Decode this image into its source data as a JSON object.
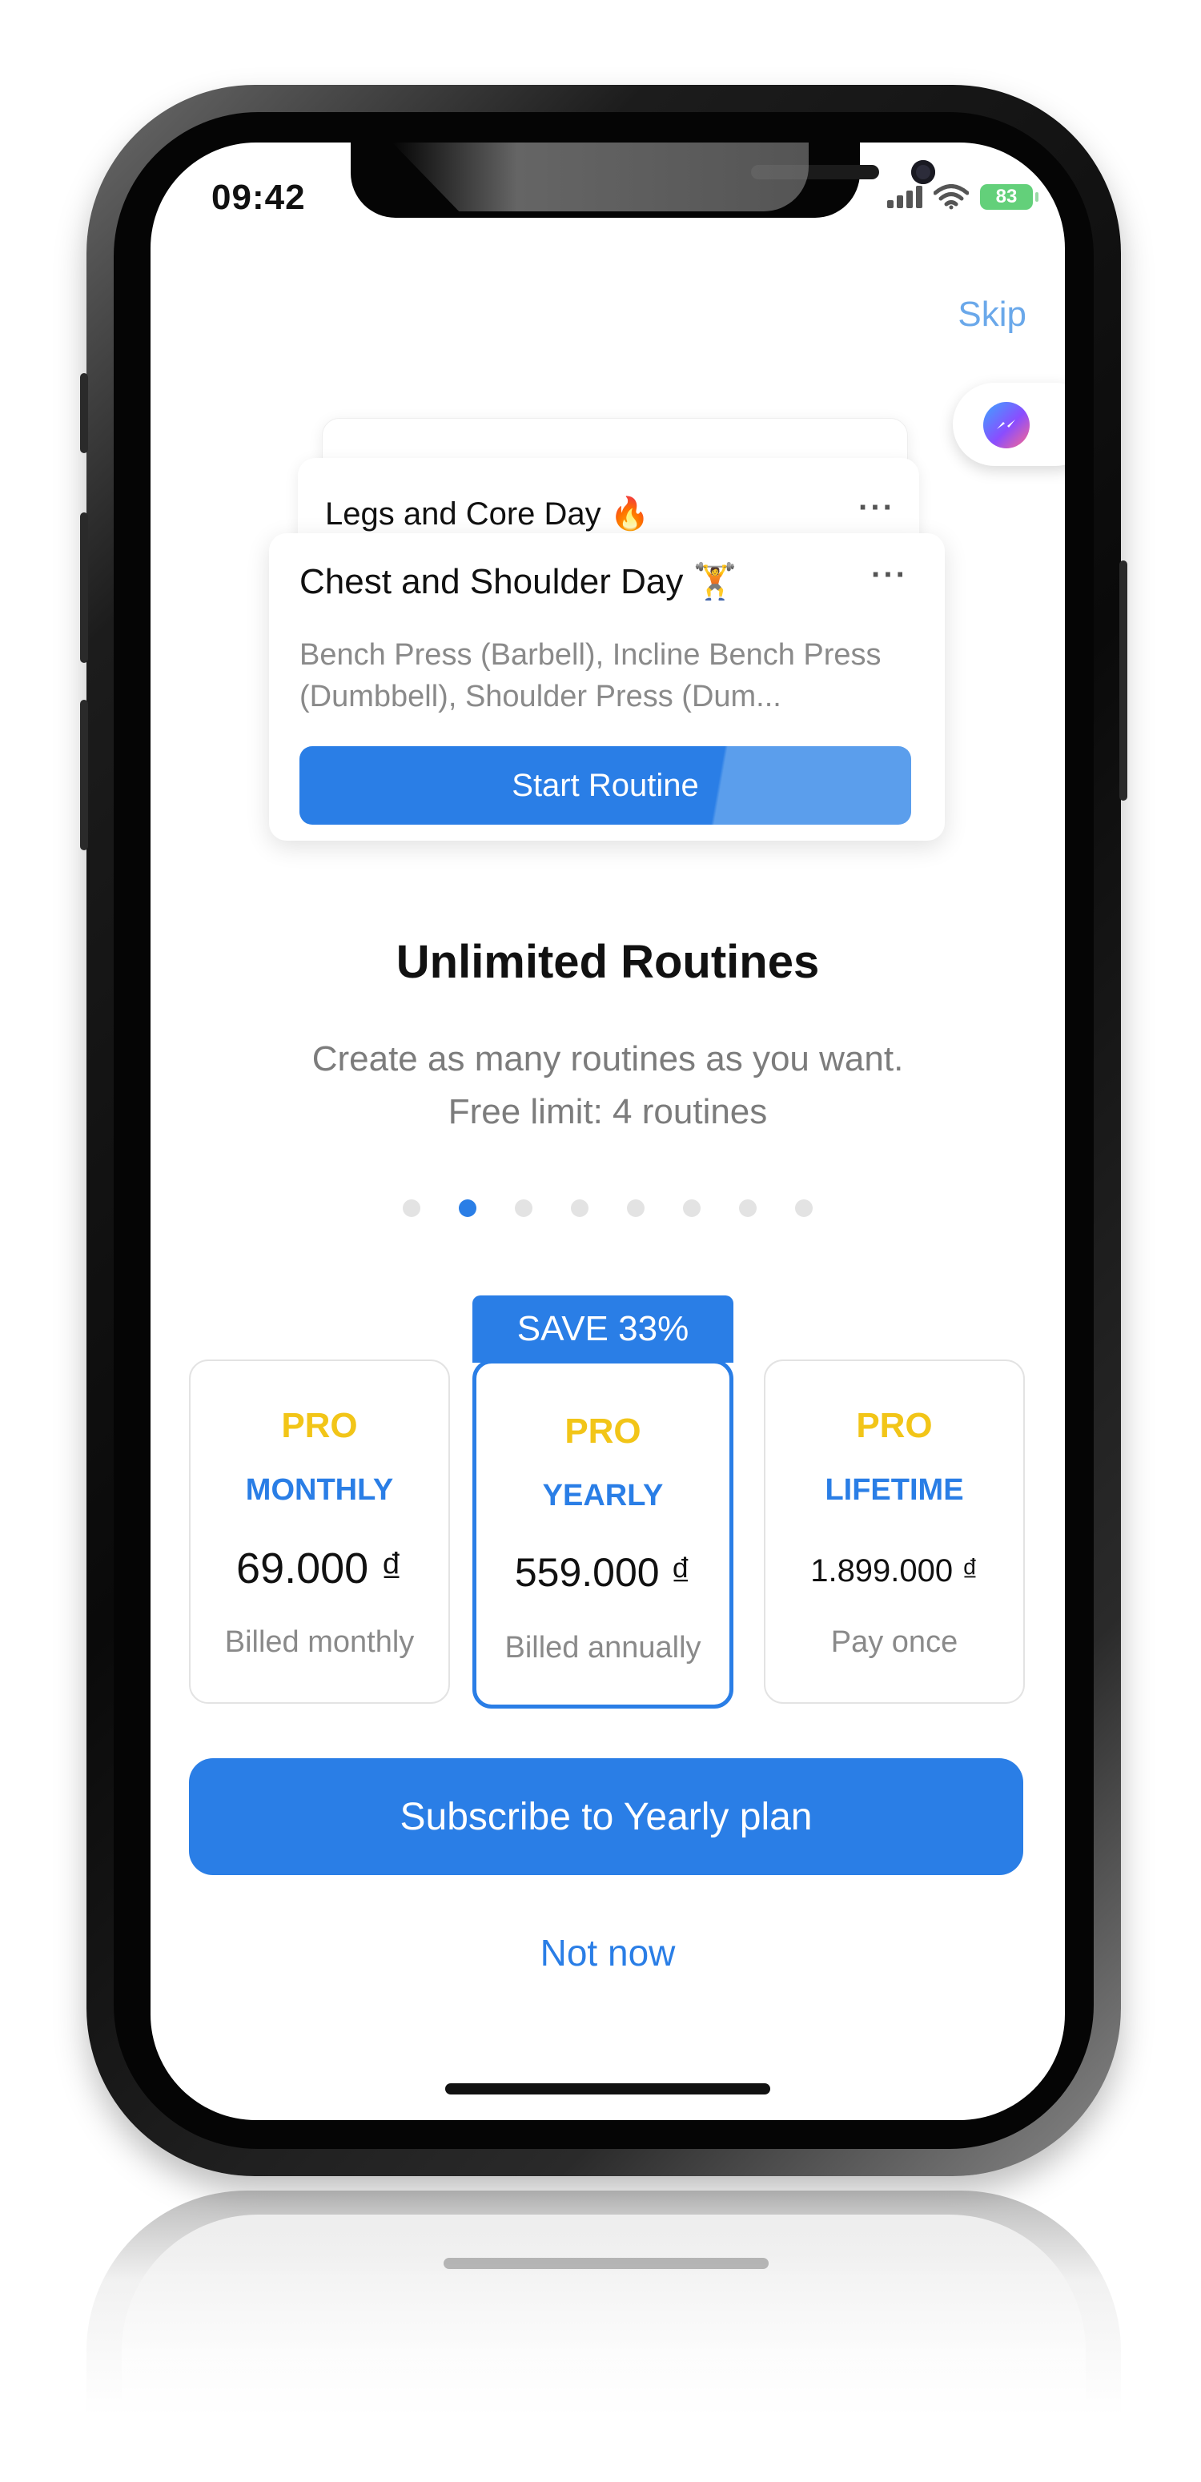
{
  "status_bar": {
    "time": "09:42",
    "battery": "83"
  },
  "header": {
    "skip_label": "Skip"
  },
  "routine_cards": {
    "back_card_title": "",
    "middle_card_title": "Legs and Core Day 🔥",
    "front_card_title": "Chest and Shoulder Day 🏋",
    "front_card_desc": "Bench Press (Barbell),  Incline Bench Press (Dumbbell), Shoulder Press (Dum...",
    "start_button_label": "Start Routine",
    "menu_glyph": "···"
  },
  "feature": {
    "title": "Unlimited Routines",
    "subtitle_line1": "Create as many routines as you want.",
    "subtitle_line2": "Free limit: 4 routines"
  },
  "pager": {
    "total": 8,
    "active_index": 1
  },
  "plans": {
    "save_badge": "SAVE 33%",
    "monthly": {
      "tier": "PRO",
      "period": "MONTHLY",
      "price": "69.000 ₫",
      "billing": "Billed monthly"
    },
    "yearly": {
      "tier": "PRO",
      "period": "YEARLY",
      "price": "559.000 ₫",
      "billing": "Billed annually"
    },
    "lifetime": {
      "tier": "PRO",
      "period": "LIFETIME",
      "price": "1.899.000 ₫",
      "billing": "Pay once"
    }
  },
  "actions": {
    "subscribe_label": "Subscribe to Yearly plan",
    "not_now_label": "Not now"
  },
  "icons": {
    "messenger": "messenger-icon",
    "signal": "signal-icon",
    "wifi": "wifi-icon",
    "battery": "battery-icon"
  },
  "colors": {
    "accent": "#2a7ee6",
    "pro_gold": "#f2c518",
    "skip_link": "#6aa8ea",
    "battery_green": "#63d07a"
  }
}
